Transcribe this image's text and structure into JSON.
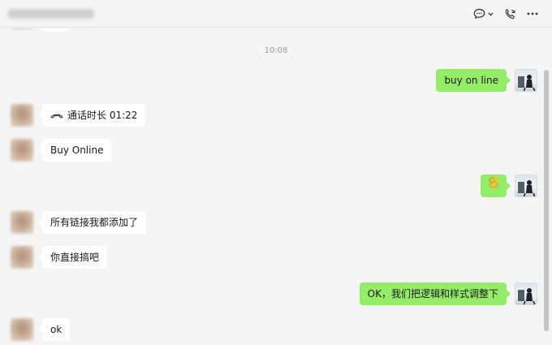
{
  "header": {
    "title": "",
    "icons": [
      "chat-bubble-icon",
      "chevron-down-icon",
      "phone-call-icon",
      "more-icon"
    ]
  },
  "timestamp": "10:08",
  "messages": [
    {
      "side": "out",
      "type": "text",
      "text": "buy on line"
    },
    {
      "side": "in",
      "type": "call",
      "text": "通话时长 01:22"
    },
    {
      "side": "in",
      "type": "text",
      "text": "Buy Online"
    },
    {
      "side": "out",
      "type": "emoji",
      "text": "👌",
      "emoji_name": "ok-hand-icon"
    },
    {
      "side": "in",
      "type": "text",
      "text": "所有链接我都添加了"
    },
    {
      "side": "in",
      "type": "text",
      "text": "你直接搞吧"
    },
    {
      "side": "out",
      "type": "text",
      "text": "OK，我们把逻辑和样式调整下"
    },
    {
      "side": "in",
      "type": "text",
      "text": "ok"
    }
  ],
  "colors": {
    "outgoing_bubble": "#95ec69",
    "incoming_bubble": "#ffffff",
    "background": "#f5f5f5"
  }
}
